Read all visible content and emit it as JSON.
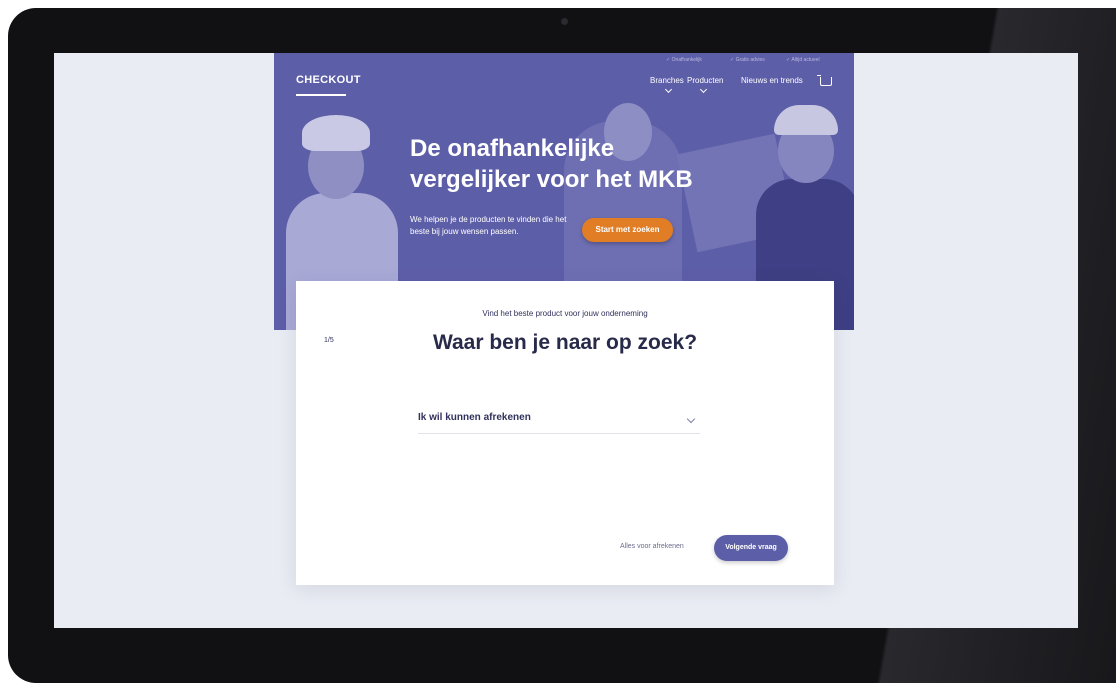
{
  "brand": {
    "logo": "CHECKOUT"
  },
  "usps": [
    "Onafhankelijk",
    "Gratis advies",
    "Altijd actueel"
  ],
  "nav": {
    "items": [
      {
        "label": "Branches",
        "has_dropdown": true
      },
      {
        "label": "Producten",
        "has_dropdown": true
      },
      {
        "label": "Nieuws en trends",
        "has_dropdown": false
      }
    ],
    "cart_icon": "cart-icon"
  },
  "hero": {
    "headline": "De onafhankelijke vergelijker voor het MKB",
    "subtext": "We helpen je de producten te vinden die het beste bij jouw wensen passen.",
    "cta": "Start met zoeken"
  },
  "wizard": {
    "subtitle": "Vind het beste product voor jouw onderneming",
    "step": "1/5",
    "question": "Waar ben je naar op zoek?",
    "select_value": "Ik wil kunnen afrekenen",
    "secondary_link": "Alles voor afrekenen",
    "next_button": "Volgende vraag"
  },
  "colors": {
    "brand": "#5d5ea8",
    "cta": "#e07d25",
    "background": "#e9ecf3"
  }
}
